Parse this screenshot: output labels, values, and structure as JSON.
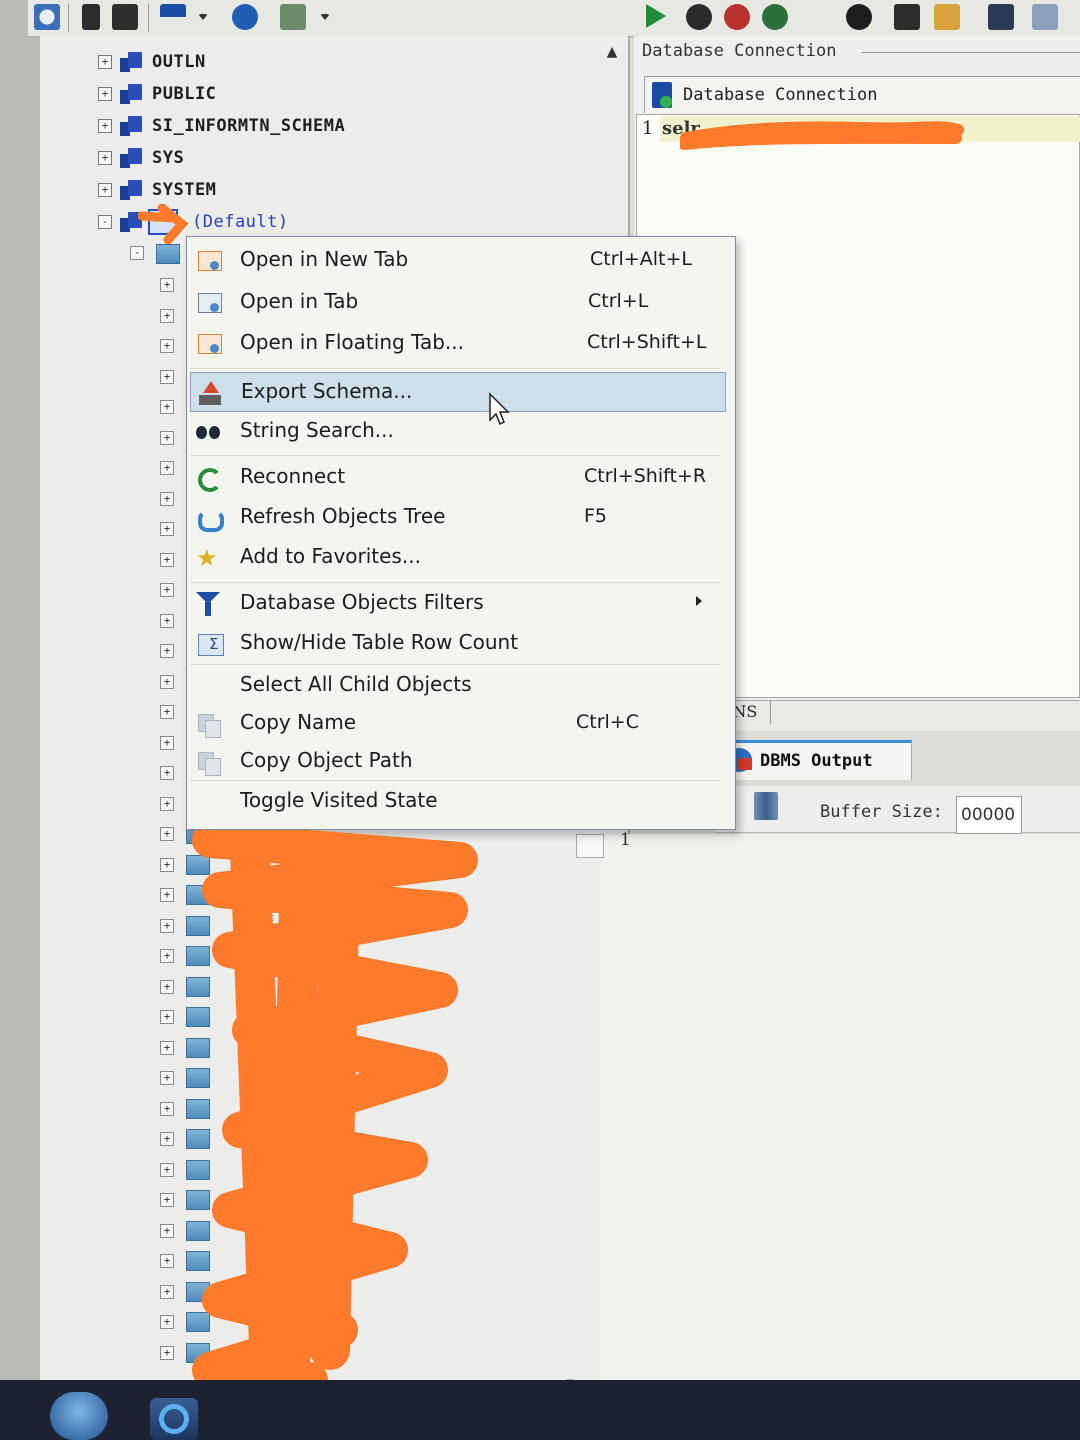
{
  "tree": {
    "schemas": [
      {
        "name": "OUTLN"
      },
      {
        "name": "PUBLIC"
      },
      {
        "name": "SI_INFORMTN_SCHEMA"
      },
      {
        "name": "SYS"
      },
      {
        "name": "SYSTEM"
      }
    ],
    "default_node": "(Default)",
    "expander_collapsed": "+",
    "expander_expanded": "-"
  },
  "connection_panel": {
    "group_title": "Database Connection",
    "tab_label": "Database Connection",
    "editor_line_number": "1",
    "editor_visible_text": "selr",
    "status_mode": "INS"
  },
  "dbms_output": {
    "tab_label": "DBMS Output",
    "buffer_label": "Buffer Size:",
    "buffer_value": "00000",
    "line_number": "1"
  },
  "context_menu": {
    "items": [
      {
        "label": "Open in New Tab",
        "shortcut": "Ctrl+Alt+L",
        "icon": "new-tab-icon"
      },
      {
        "label": "Open in Tab",
        "shortcut": "Ctrl+L",
        "icon": "tab-icon"
      },
      {
        "label": "Open in Floating Tab...",
        "shortcut": "Ctrl+Shift+L",
        "icon": "floating-tab-icon"
      },
      {
        "label": "Export Schema...",
        "shortcut": "",
        "icon": "export-icon",
        "highlighted": true
      },
      {
        "label": "String Search...",
        "shortcut": "",
        "icon": "binoculars-icon"
      },
      {
        "label": "Reconnect",
        "shortcut": "Ctrl+Shift+R",
        "icon": "reconnect-icon"
      },
      {
        "label": "Refresh Objects Tree",
        "shortcut": "F5",
        "icon": "refresh-icon"
      },
      {
        "label": "Add to Favorites...",
        "shortcut": "",
        "icon": "star-icon"
      },
      {
        "label": "Database Objects Filters",
        "shortcut": "",
        "icon": "filter-icon",
        "submenu": true
      },
      {
        "label": "Show/Hide Table Row Count",
        "shortcut": "",
        "icon": "row-count-icon"
      },
      {
        "label": "Select All Child Objects",
        "shortcut": "",
        "icon": ""
      },
      {
        "label": "Copy Name",
        "shortcut": "Ctrl+C",
        "icon": "copy-icon"
      },
      {
        "label": "Copy Object Path",
        "shortcut": "",
        "icon": "copy-path-icon"
      },
      {
        "label": "Toggle Visited State",
        "shortcut": "",
        "icon": ""
      }
    ]
  },
  "colors": {
    "menu_highlight": "#cde0ea",
    "redaction": "#ff7a2a",
    "schema_icon": "#284fb3"
  }
}
